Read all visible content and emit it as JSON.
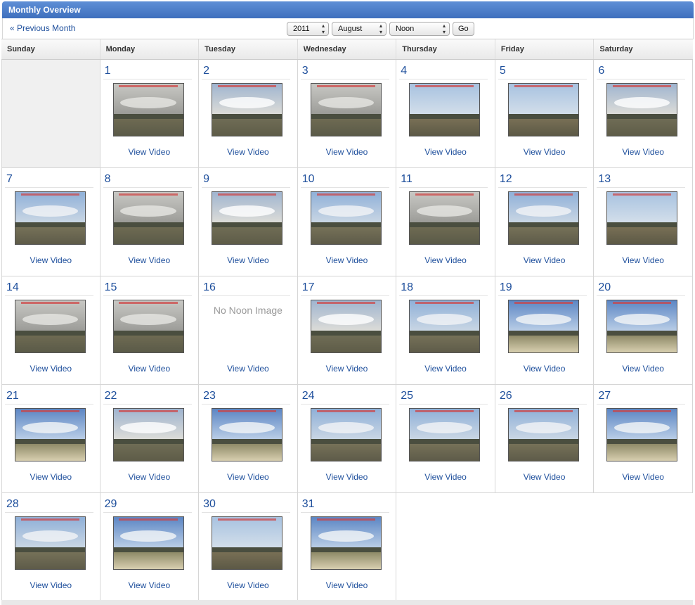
{
  "header": {
    "title": "Monthly Overview"
  },
  "toolbar": {
    "prev_label": "« Previous Month",
    "year": "2011",
    "month": "August",
    "time": "Noon",
    "go_label": "Go"
  },
  "weekdays": [
    "Sunday",
    "Monday",
    "Tuesday",
    "Wednesday",
    "Thursday",
    "Friday",
    "Saturday"
  ],
  "leading_blanks": 1,
  "view_label": "View Video",
  "no_image_label": "No Noon Image",
  "days": [
    {
      "n": "1",
      "sky": "overcast"
    },
    {
      "n": "2",
      "sky": "cloudy"
    },
    {
      "n": "3",
      "sky": "overcast"
    },
    {
      "n": "4",
      "sky": "clear"
    },
    {
      "n": "5",
      "sky": "clear"
    },
    {
      "n": "6",
      "sky": "cloudy"
    },
    {
      "n": "7",
      "sky": "partly"
    },
    {
      "n": "8",
      "sky": "overcast"
    },
    {
      "n": "9",
      "sky": "cloudy"
    },
    {
      "n": "10",
      "sky": "partly"
    },
    {
      "n": "11",
      "sky": "overcast"
    },
    {
      "n": "12",
      "sky": "partly"
    },
    {
      "n": "13",
      "sky": "clear"
    },
    {
      "n": "14",
      "sky": "overcast"
    },
    {
      "n": "15",
      "sky": "overcast"
    },
    {
      "n": "16",
      "sky": "none"
    },
    {
      "n": "17",
      "sky": "cloudy"
    },
    {
      "n": "18",
      "sky": "partly"
    },
    {
      "n": "19",
      "sky": "blue"
    },
    {
      "n": "20",
      "sky": "blue"
    },
    {
      "n": "21",
      "sky": "blue"
    },
    {
      "n": "22",
      "sky": "cloudy"
    },
    {
      "n": "23",
      "sky": "blue"
    },
    {
      "n": "24",
      "sky": "partly"
    },
    {
      "n": "25",
      "sky": "partly"
    },
    {
      "n": "26",
      "sky": "partly"
    },
    {
      "n": "27",
      "sky": "blue"
    },
    {
      "n": "28",
      "sky": "partly"
    },
    {
      "n": "29",
      "sky": "blue"
    },
    {
      "n": "30",
      "sky": "clear"
    },
    {
      "n": "31",
      "sky": "blue"
    }
  ],
  "colors": {
    "header": "#3e6fbd",
    "link": "#1e4f9c"
  }
}
